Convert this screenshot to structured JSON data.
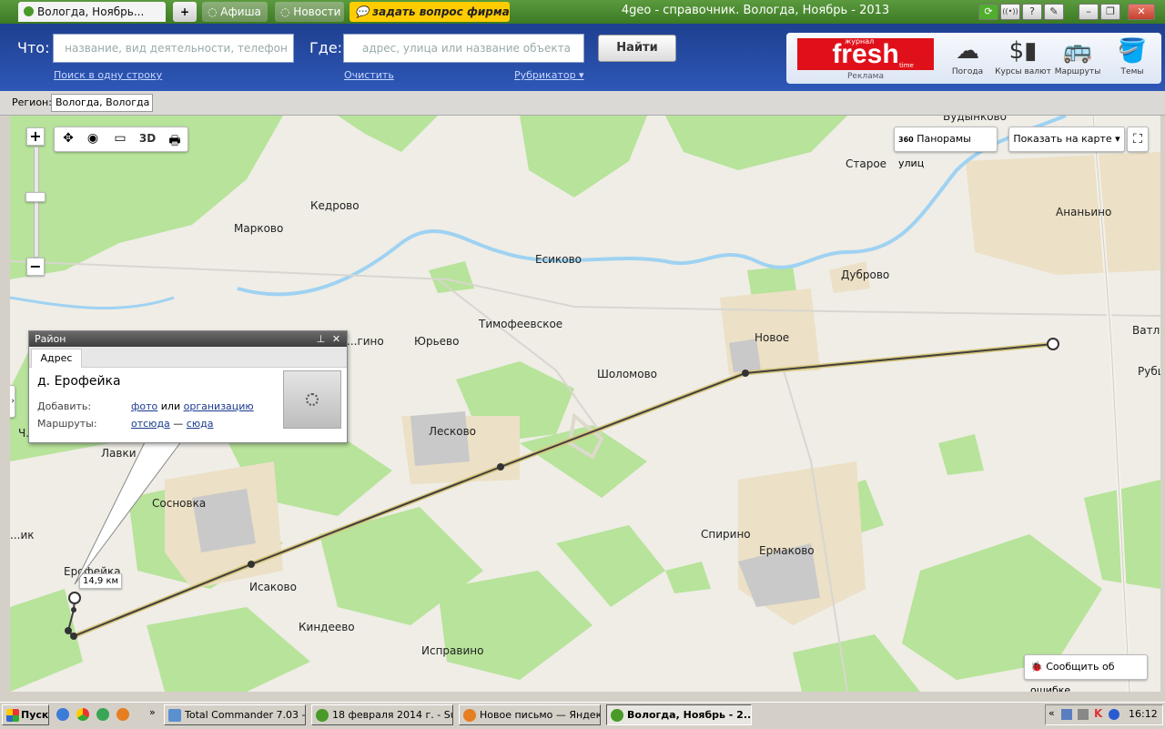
{
  "browser": {
    "active_tab": "Вологда, Ноябрь...",
    "new_tab_symbol": "+",
    "tabs": [
      "Афиша",
      "Новости"
    ],
    "ask_button": "задать вопрос фирмам",
    "window_title": "4geo - справочник. Вологда, Ноябрь - 2013",
    "tool_buttons": [
      "⟳",
      "((•))",
      "?",
      "✎"
    ],
    "window_controls": [
      "–",
      "❐",
      "✕"
    ]
  },
  "search": {
    "what_label": "Что:",
    "what_placeholder": "название, вид деятельности, телефон",
    "where_label": "Где:",
    "where_placeholder": "адрес, улица или название объекта",
    "find_label": "Найти",
    "one_line_link": "Поиск в одну строку",
    "clear_link": "Очистить",
    "rubricator_link": "Рубрикатор ▾"
  },
  "ad": {
    "brand_small": "журнал",
    "brand": "fresh",
    "brand_sub": "time",
    "label": "Реклама"
  },
  "services": [
    {
      "label": "Погода",
      "icon": "weather-icon"
    },
    {
      "label": "Курсы валют",
      "icon": "currency-icon"
    },
    {
      "label": "Маршруты",
      "icon": "bus-icon"
    },
    {
      "label": "Темы",
      "icon": "paint-bucket-icon"
    }
  ],
  "region": {
    "label": "Регион:",
    "value": "Вологда, Вологда"
  },
  "map": {
    "zoom_in": "+",
    "zoom_out": "−",
    "tools": [
      "✥",
      "◉",
      "▭",
      "3D",
      "🖶"
    ],
    "panorama": "Панорамы улиц",
    "panorama_badge": "360",
    "show_on_map": "Показать на карте ▾",
    "report_error": "Сообщить об ошибке",
    "distance": "14,9 км",
    "places": [
      "Кедрово",
      "Марково",
      "Есиково",
      "Старое",
      "Ананьино",
      "Дуброво",
      "Тимофеевское",
      "Новое",
      "Ватланово",
      "Рубцово",
      "Юрьево",
      "Шоломово",
      "...гино",
      "Лесково",
      "Лавки",
      "Ч...",
      "Сосновка",
      "Спирино",
      "Ермаково",
      "Исаково",
      "Киндеево",
      "Исправино",
      "Ерофейка",
      "...ик",
      "Будынково"
    ]
  },
  "popup": {
    "title": "Район",
    "tab": "Адрес",
    "place_name": "д. Ерофейка",
    "add_label": "Добавить:",
    "add_photo": "фото",
    "add_or": "или",
    "add_org": "организацию",
    "routes_label": "Маршруты:",
    "route_from": "отсюда",
    "route_dash": "—",
    "route_to": "сюда"
  },
  "taskbar": {
    "start": "Пуск",
    "items": [
      "Total Commander 7.03 - ...",
      "18 февраля 2014 г. - Su...",
      "Новое письмо — Яндек...",
      "Вологда, Ноябрь - 2..."
    ],
    "clock": "16:12"
  }
}
